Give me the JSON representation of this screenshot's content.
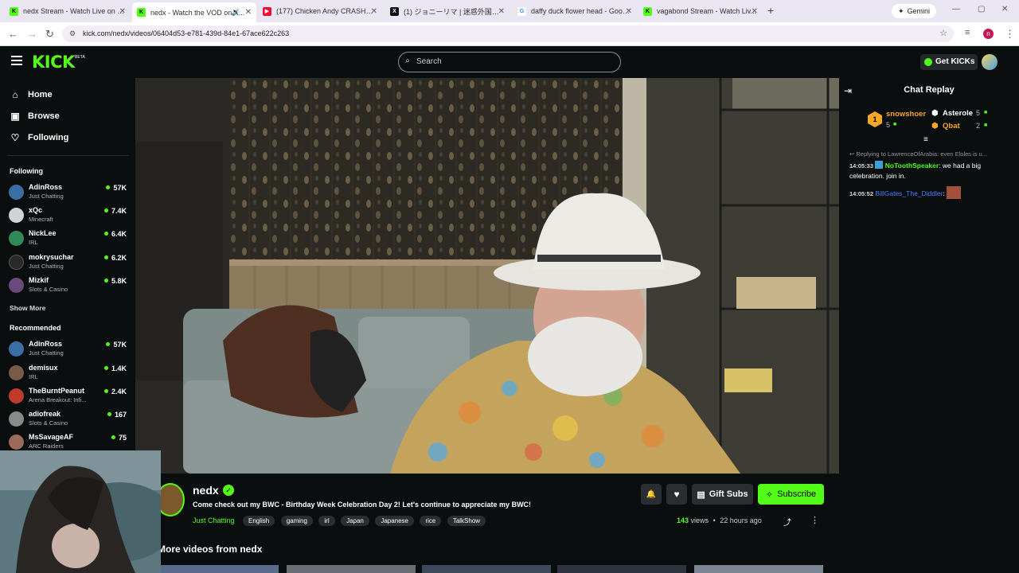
{
  "browser": {
    "tabs": [
      {
        "title": "nedx Stream - Watch Live on Ki...",
        "fav_color": "#53fc18",
        "fav_text": "K"
      },
      {
        "title": "nedx - Watch the VOD on K...",
        "fav_color": "#53fc18",
        "fav_text": "K"
      },
      {
        "title": "(177) Chicken Andy CRASHES N...",
        "fav_color": "#ff0033",
        "fav_text": "▶"
      },
      {
        "title": "(1) ジョニーリマ | 迷惑外国人拡...",
        "fav_color": "#111111",
        "fav_text": "X"
      },
      {
        "title": "daffy duck flower head - Googl...",
        "fav_color": "#ffffff",
        "fav_text": "G"
      },
      {
        "title": "vagabond Stream - Watch Liv...",
        "fav_color": "#53fc18",
        "fav_text": "K"
      }
    ],
    "gemini_label": "Gemini",
    "url": "kick.com/nedx/videos/06404d53-e781-439d-84e1-67ace622c263",
    "profile_initial": "n"
  },
  "header": {
    "logo": "KICK",
    "logo_badge": "BETA",
    "search_placeholder": "Search",
    "get_kicks": "Get KICKs"
  },
  "sidebar": {
    "nav": [
      {
        "label": "Home",
        "icon": "home-icon",
        "glyph": "⌂"
      },
      {
        "label": "Browse",
        "icon": "browse-icon",
        "glyph": "▣"
      },
      {
        "label": "Following",
        "icon": "heart-icon",
        "glyph": "♡"
      }
    ],
    "following_title": "Following",
    "following": [
      {
        "name": "AdinRoss",
        "game": "Just Chatting",
        "viewers": "57K",
        "color": "#3a6ea5"
      },
      {
        "name": "xQc",
        "game": "Minecraft",
        "viewers": "7.4K",
        "color": "#cfd3d6"
      },
      {
        "name": "NickLee",
        "game": "IRL",
        "viewers": "6.4K",
        "color": "#2e8b57"
      },
      {
        "name": "mokrysuchar",
        "game": "Just Chatting",
        "viewers": "6.2K",
        "color": "#2a2a2a"
      },
      {
        "name": "Mizkif",
        "game": "Slots & Casino",
        "viewers": "5.8K",
        "color": "#6a4a7a"
      }
    ],
    "show_more": "Show More",
    "recommended_title": "Recommended",
    "recommended": [
      {
        "name": "AdinRoss",
        "game": "Just Chatting",
        "viewers": "57K",
        "color": "#3a6ea5"
      },
      {
        "name": "demisux",
        "game": "IRL",
        "viewers": "1.4K",
        "color": "#7a5a4a"
      },
      {
        "name": "TheBurntPeanut",
        "game": "Arena Breakout: Infi...",
        "viewers": "2.4K",
        "color": "#c0392b"
      },
      {
        "name": "adiofreak",
        "game": "Slots & Casino",
        "viewers": "167",
        "color": "#8a8a8a"
      },
      {
        "name": "MsSavageAF",
        "game": "ARC Raiders",
        "viewers": "75",
        "color": "#9a6a5a"
      }
    ]
  },
  "chat": {
    "title": "Chat Replay",
    "leaderboard": [
      {
        "rank": "1",
        "name": "snowshoer",
        "count": "5",
        "color": "#f5a623"
      },
      {
        "name": "Asterole",
        "count": "5",
        "color": "#ffffff"
      },
      {
        "name": "Qbat",
        "count": "2",
        "color": "#f5a623"
      }
    ],
    "reply_note": "Replying to LawrenceOfArabia: even Eloles is u...",
    "messages": [
      {
        "time": "14:05:33",
        "user": "NoToothSpeaker",
        "user_color": "#53fc18",
        "text": "we had a big celebration. join in."
      },
      {
        "time": "14:05:52",
        "user": "BillGates_The_Diddler",
        "user_color": "#4a7bff",
        "text": ""
      }
    ]
  },
  "stream": {
    "channel": "nedx",
    "title": "Come check out my BWC - Birthday Week Celebration Day 2! Let's continue to appreciate my BWC!",
    "category": "Just Chatting",
    "tags": [
      "English",
      "gaming",
      "irl",
      "Japan",
      "Japanese",
      "rice",
      "TalkShow"
    ],
    "views_count": "143",
    "views_label": "views",
    "age": "22 hours ago",
    "gift_subs": "Gift Subs",
    "subscribe": "Subscribe",
    "more_videos": "More videos from nedx"
  },
  "colors": {
    "accent": "#53fc18",
    "bg": "#0b0e0f"
  }
}
